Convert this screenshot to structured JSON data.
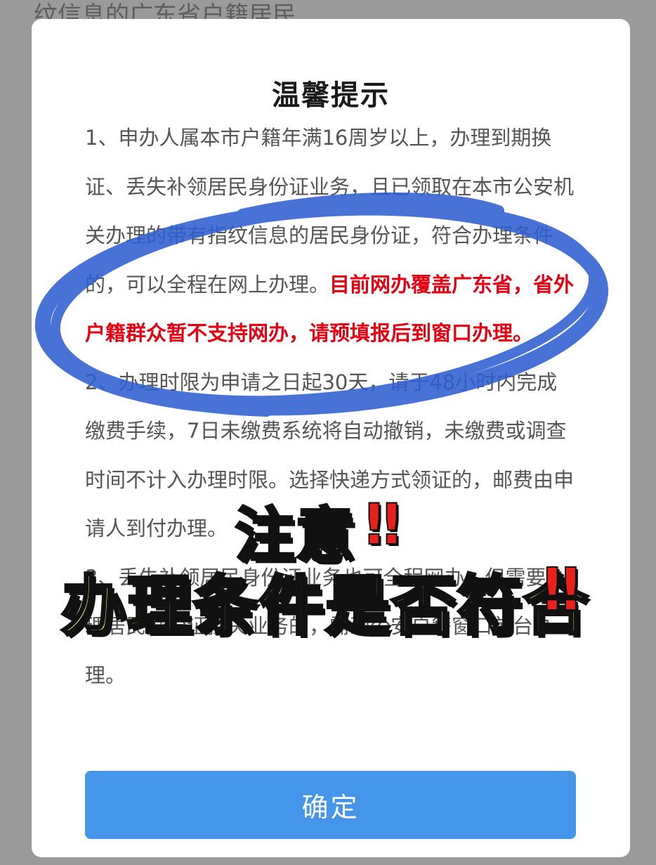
{
  "background": {
    "partial_text": "纹信息的广东省户籍居民"
  },
  "modal": {
    "title": "温馨提示",
    "item1_part1": "1、申办人属本市户籍年满16周岁以上，办理到期换证、丢失补领居民身份证业务，且已领取在本市公安机关办理的带有指纹信息的居民身份证，符合办理条件的，可以全程在网上办理。",
    "item1_highlight": "目前网办覆盖广东省，省外户籍群众暂不支持网办，请预填报后到窗口办理。",
    "item2": "2、办理时限为申请之日起30天，请于48小时内完成缴费手续，7日未缴费系统将自动撤销，未缴费或调查时间不计入办理时限。选择快递方式领证的，邮费由申请人到付办理。",
    "item3": "3、丢失补领居民身份证业务也可全程网办，但需要办理居民身份证挂失业务的，需到公安户籍窗口前台办理。",
    "confirm_label": "确定"
  },
  "overlay": {
    "sticker_line1": "注意",
    "sticker_line2": "办理条件是否符合",
    "exclaim": "‼"
  },
  "colors": {
    "highlight": "#e60012",
    "button": "#4595ea",
    "scribble": "#2f5fd0",
    "sticker_fill": "#f8ef8f"
  }
}
